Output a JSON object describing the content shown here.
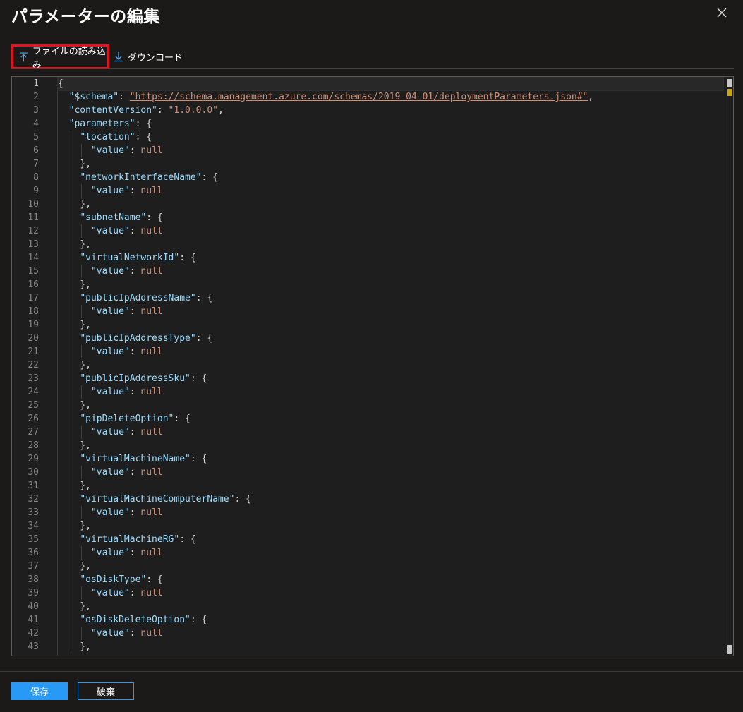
{
  "header": {
    "title": "パラメーターの編集",
    "more_label": "···"
  },
  "toolbar": {
    "upload_label": "ファイルの読み込み",
    "download_label": "ダウンロード",
    "upload_icon": "upload-icon",
    "download_icon": "download-icon",
    "highlight_color": "#e81123"
  },
  "editor": {
    "lines": [
      {
        "n": "1",
        "indent": 0,
        "parts": [
          [
            "pun",
            "{"
          ]
        ]
      },
      {
        "n": "2",
        "indent": 1,
        "parts": [
          [
            "key",
            "\"$schema\""
          ],
          [
            "pun",
            ": "
          ],
          [
            "link",
            "\"https://schema.management.azure.com/schemas/2019-04-01/deploymentParameters.json#\""
          ],
          [
            "pun",
            ","
          ]
        ]
      },
      {
        "n": "3",
        "indent": 1,
        "parts": [
          [
            "key",
            "\"contentVersion\""
          ],
          [
            "pun",
            ": "
          ],
          [
            "str",
            "\"1.0.0.0\""
          ],
          [
            "pun",
            ","
          ]
        ]
      },
      {
        "n": "4",
        "indent": 1,
        "parts": [
          [
            "key",
            "\"parameters\""
          ],
          [
            "pun",
            ": {"
          ]
        ]
      },
      {
        "n": "5",
        "indent": 2,
        "parts": [
          [
            "key",
            "\"location\""
          ],
          [
            "pun",
            ": {"
          ]
        ]
      },
      {
        "n": "6",
        "indent": 3,
        "parts": [
          [
            "key",
            "\"value\""
          ],
          [
            "pun",
            ": "
          ],
          [
            "nul",
            "null"
          ]
        ]
      },
      {
        "n": "7",
        "indent": 2,
        "parts": [
          [
            "pun",
            "},"
          ]
        ]
      },
      {
        "n": "8",
        "indent": 2,
        "parts": [
          [
            "key",
            "\"networkInterfaceName\""
          ],
          [
            "pun",
            ": {"
          ]
        ]
      },
      {
        "n": "9",
        "indent": 3,
        "parts": [
          [
            "key",
            "\"value\""
          ],
          [
            "pun",
            ": "
          ],
          [
            "nul",
            "null"
          ]
        ]
      },
      {
        "n": "10",
        "indent": 2,
        "parts": [
          [
            "pun",
            "},"
          ]
        ]
      },
      {
        "n": "11",
        "indent": 2,
        "parts": [
          [
            "key",
            "\"subnetName\""
          ],
          [
            "pun",
            ": {"
          ]
        ]
      },
      {
        "n": "12",
        "indent": 3,
        "parts": [
          [
            "key",
            "\"value\""
          ],
          [
            "pun",
            ": "
          ],
          [
            "nul",
            "null"
          ]
        ]
      },
      {
        "n": "13",
        "indent": 2,
        "parts": [
          [
            "pun",
            "},"
          ]
        ]
      },
      {
        "n": "14",
        "indent": 2,
        "parts": [
          [
            "key",
            "\"virtualNetworkId\""
          ],
          [
            "pun",
            ": {"
          ]
        ]
      },
      {
        "n": "15",
        "indent": 3,
        "parts": [
          [
            "key",
            "\"value\""
          ],
          [
            "pun",
            ": "
          ],
          [
            "nul",
            "null"
          ]
        ]
      },
      {
        "n": "16",
        "indent": 2,
        "parts": [
          [
            "pun",
            "},"
          ]
        ]
      },
      {
        "n": "17",
        "indent": 2,
        "parts": [
          [
            "key",
            "\"publicIpAddressName\""
          ],
          [
            "pun",
            ": {"
          ]
        ]
      },
      {
        "n": "18",
        "indent": 3,
        "parts": [
          [
            "key",
            "\"value\""
          ],
          [
            "pun",
            ": "
          ],
          [
            "nul",
            "null"
          ]
        ]
      },
      {
        "n": "19",
        "indent": 2,
        "parts": [
          [
            "pun",
            "},"
          ]
        ]
      },
      {
        "n": "20",
        "indent": 2,
        "parts": [
          [
            "key",
            "\"publicIpAddressType\""
          ],
          [
            "pun",
            ": {"
          ]
        ]
      },
      {
        "n": "21",
        "indent": 3,
        "parts": [
          [
            "key",
            "\"value\""
          ],
          [
            "pun",
            ": "
          ],
          [
            "nul",
            "null"
          ]
        ]
      },
      {
        "n": "22",
        "indent": 2,
        "parts": [
          [
            "pun",
            "},"
          ]
        ]
      },
      {
        "n": "23",
        "indent": 2,
        "parts": [
          [
            "key",
            "\"publicIpAddressSku\""
          ],
          [
            "pun",
            ": {"
          ]
        ]
      },
      {
        "n": "24",
        "indent": 3,
        "parts": [
          [
            "key",
            "\"value\""
          ],
          [
            "pun",
            ": "
          ],
          [
            "nul",
            "null"
          ]
        ]
      },
      {
        "n": "25",
        "indent": 2,
        "parts": [
          [
            "pun",
            "},"
          ]
        ]
      },
      {
        "n": "26",
        "indent": 2,
        "parts": [
          [
            "key",
            "\"pipDeleteOption\""
          ],
          [
            "pun",
            ": {"
          ]
        ]
      },
      {
        "n": "27",
        "indent": 3,
        "parts": [
          [
            "key",
            "\"value\""
          ],
          [
            "pun",
            ": "
          ],
          [
            "nul",
            "null"
          ]
        ]
      },
      {
        "n": "28",
        "indent": 2,
        "parts": [
          [
            "pun",
            "},"
          ]
        ]
      },
      {
        "n": "29",
        "indent": 2,
        "parts": [
          [
            "key",
            "\"virtualMachineName\""
          ],
          [
            "pun",
            ": {"
          ]
        ]
      },
      {
        "n": "30",
        "indent": 3,
        "parts": [
          [
            "key",
            "\"value\""
          ],
          [
            "pun",
            ": "
          ],
          [
            "nul",
            "null"
          ]
        ]
      },
      {
        "n": "31",
        "indent": 2,
        "parts": [
          [
            "pun",
            "},"
          ]
        ]
      },
      {
        "n": "32",
        "indent": 2,
        "parts": [
          [
            "key",
            "\"virtualMachineComputerName\""
          ],
          [
            "pun",
            ": {"
          ]
        ]
      },
      {
        "n": "33",
        "indent": 3,
        "parts": [
          [
            "key",
            "\"value\""
          ],
          [
            "pun",
            ": "
          ],
          [
            "nul",
            "null"
          ]
        ]
      },
      {
        "n": "34",
        "indent": 2,
        "parts": [
          [
            "pun",
            "},"
          ]
        ]
      },
      {
        "n": "35",
        "indent": 2,
        "parts": [
          [
            "key",
            "\"virtualMachineRG\""
          ],
          [
            "pun",
            ": {"
          ]
        ]
      },
      {
        "n": "36",
        "indent": 3,
        "parts": [
          [
            "key",
            "\"value\""
          ],
          [
            "pun",
            ": "
          ],
          [
            "nul",
            "null"
          ]
        ]
      },
      {
        "n": "37",
        "indent": 2,
        "parts": [
          [
            "pun",
            "},"
          ]
        ]
      },
      {
        "n": "38",
        "indent": 2,
        "parts": [
          [
            "key",
            "\"osDiskType\""
          ],
          [
            "pun",
            ": {"
          ]
        ]
      },
      {
        "n": "39",
        "indent": 3,
        "parts": [
          [
            "key",
            "\"value\""
          ],
          [
            "pun",
            ": "
          ],
          [
            "nul",
            "null"
          ]
        ]
      },
      {
        "n": "40",
        "indent": 2,
        "parts": [
          [
            "pun",
            "},"
          ]
        ]
      },
      {
        "n": "41",
        "indent": 2,
        "parts": [
          [
            "key",
            "\"osDiskDeleteOption\""
          ],
          [
            "pun",
            ": {"
          ]
        ]
      },
      {
        "n": "42",
        "indent": 3,
        "parts": [
          [
            "key",
            "\"value\""
          ],
          [
            "pun",
            ": "
          ],
          [
            "nul",
            "null"
          ]
        ]
      },
      {
        "n": "43",
        "indent": 2,
        "parts": [
          [
            "pun",
            "},"
          ]
        ]
      }
    ]
  },
  "footer": {
    "save_label": "保存",
    "discard_label": "破棄"
  },
  "colors": {
    "accent": "#2899f5",
    "background": "#1b1a19",
    "editor_bg": "#1e1e1e",
    "key": "#9cdcfe",
    "string": "#ce9178"
  }
}
